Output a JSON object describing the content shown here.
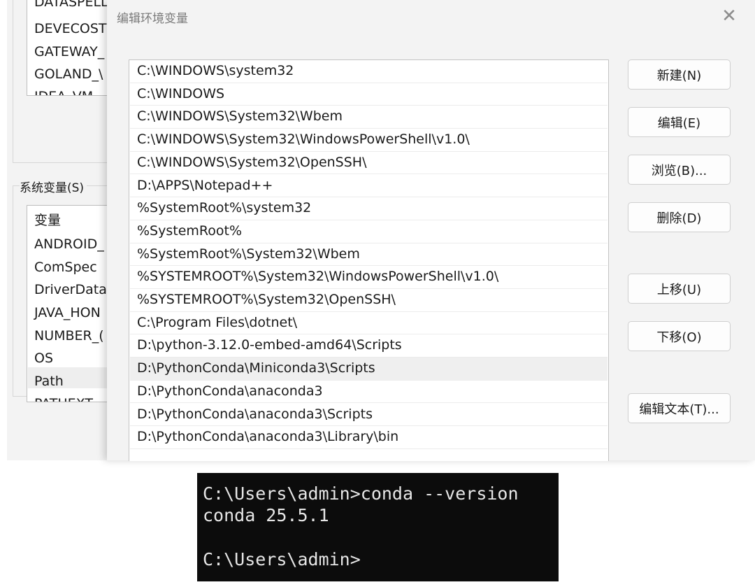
{
  "background_window": {
    "user_variables": [
      "DATASPELL",
      "DEVECOST",
      "GATEWAY_",
      "GOLAND_\\",
      "IDEA_VM_"
    ],
    "system_variables_label": "系统变量(S)",
    "system_variables": {
      "header": "变量",
      "rows": [
        "ANDROID_",
        "ComSpec",
        "DriverData",
        "JAVA_HON",
        "NUMBER_(",
        "OS",
        "Path",
        "PATHEXT"
      ]
    }
  },
  "dialog": {
    "title": "编辑环境变量",
    "close_icon": "close-icon",
    "paths": [
      "C:\\WINDOWS\\system32",
      "C:\\WINDOWS",
      "C:\\WINDOWS\\System32\\Wbem",
      "C:\\WINDOWS\\System32\\WindowsPowerShell\\v1.0\\",
      "C:\\WINDOWS\\System32\\OpenSSH\\",
      "D:\\APPS\\Notepad++",
      "%SystemRoot%\\system32",
      "%SystemRoot%",
      "%SystemRoot%\\System32\\Wbem",
      "%SYSTEMROOT%\\System32\\WindowsPowerShell\\v1.0\\",
      "%SYSTEMROOT%\\System32\\OpenSSH\\",
      "C:\\Program Files\\dotnet\\",
      "D:\\python-3.12.0-embed-amd64\\Scripts",
      "D:\\PythonConda\\Miniconda3\\Scripts",
      "D:\\PythonConda\\anaconda3",
      "D:\\PythonConda\\anaconda3\\Scripts",
      "D:\\PythonConda\\anaconda3\\Library\\bin"
    ],
    "selected_index": 13,
    "buttons": {
      "new": "新建(N)",
      "edit": "编辑(E)",
      "browse": "浏览(B)...",
      "delete": "删除(D)",
      "move_up": "上移(U)",
      "move_down": "下移(O)",
      "edit_text": "编辑文本(T)..."
    }
  },
  "terminal": {
    "lines": [
      "C:\\Users\\admin>conda --version",
      "conda 25.5.1",
      "",
      "C:\\Users\\admin>"
    ]
  },
  "colors": {
    "dialog_bg": "#f3f3f3",
    "list_bg": "#ffffff",
    "selected_row": "#efefef",
    "terminal_bg": "#0c0c0c",
    "terminal_fg": "#e6e6e6"
  }
}
